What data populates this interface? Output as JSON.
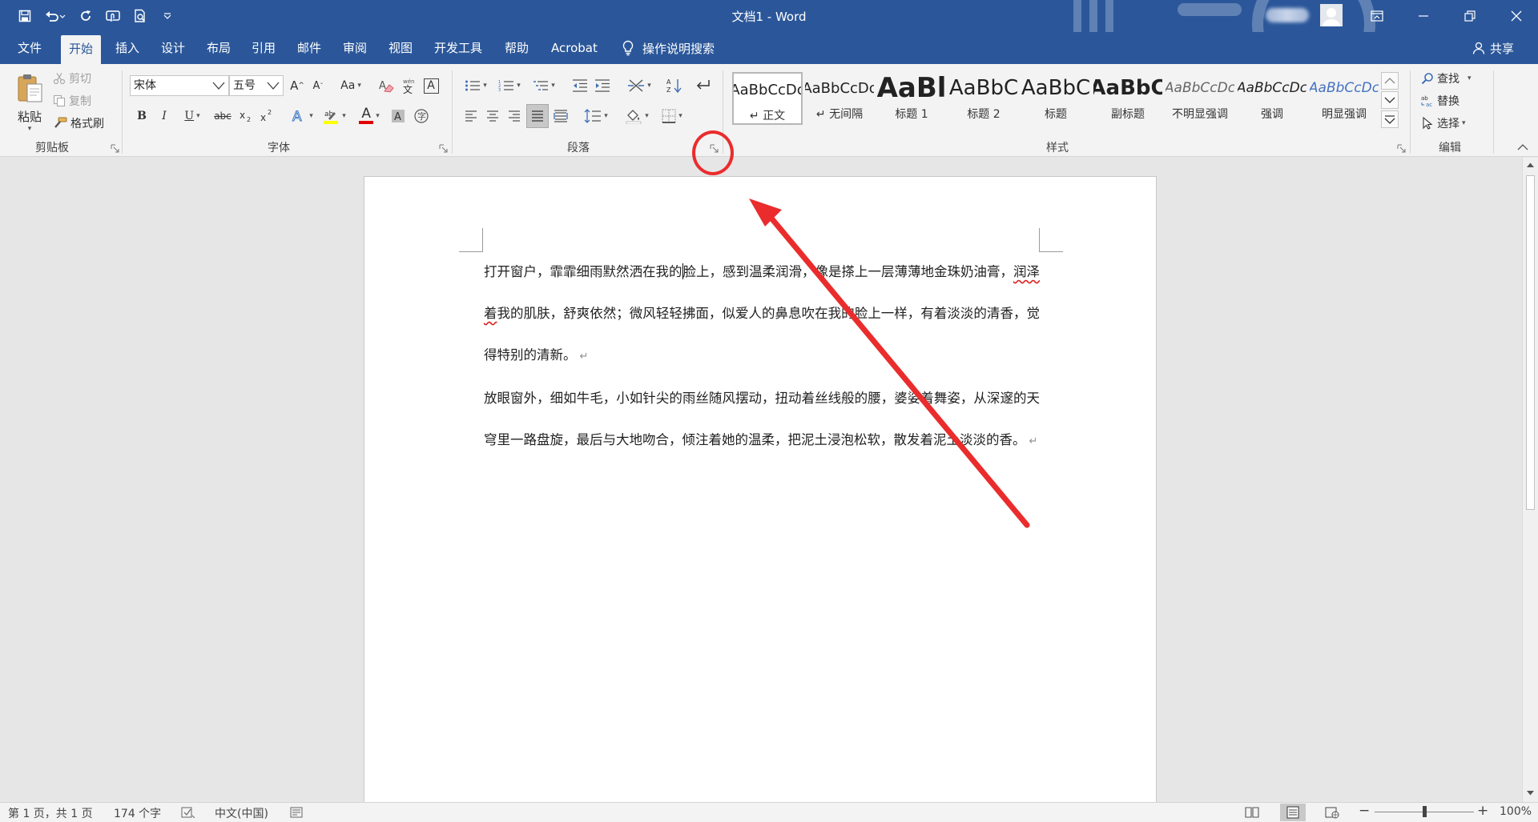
{
  "app": {
    "doc_title": "文档1 - Word"
  },
  "qat": [
    {
      "name": "save-button"
    },
    {
      "name": "undo-button"
    },
    {
      "name": "redo-button"
    },
    {
      "name": "touch-mode-button"
    },
    {
      "name": "print-preview-button"
    },
    {
      "name": "customize-qat-button"
    }
  ],
  "tabs": [
    {
      "label": "文件"
    },
    {
      "label": "开始"
    },
    {
      "label": "插入"
    },
    {
      "label": "设计"
    },
    {
      "label": "布局"
    },
    {
      "label": "引用"
    },
    {
      "label": "邮件"
    },
    {
      "label": "审阅"
    },
    {
      "label": "视图"
    },
    {
      "label": "开发工具"
    },
    {
      "label": "帮助"
    },
    {
      "label": "Acrobat"
    }
  ],
  "tell_me": "操作说明搜索",
  "share": "共享",
  "clipboard": {
    "paste": "粘贴",
    "cut": "剪切",
    "copy": "复制",
    "format_painter": "格式刷",
    "label": "剪贴板"
  },
  "font": {
    "name": "宋体",
    "size": "五号",
    "label": "字体",
    "bold": "B",
    "italic": "I",
    "underline": "U",
    "strike": "abc",
    "change_case": "Aa",
    "char_border": "A",
    "font_color": "A",
    "grow": "A",
    "shrink": "A"
  },
  "paragraph": {
    "label": "段落"
  },
  "styles": {
    "label": "样式",
    "items": [
      {
        "sample": "AaBbCcDc",
        "name": "↵ 正文"
      },
      {
        "sample": "AaBbCcDc",
        "name": "↵ 无间隔"
      },
      {
        "sample": "AaBl",
        "name": "标题 1"
      },
      {
        "sample": "AaBbC",
        "name": "标题 2"
      },
      {
        "sample": "AaBbC",
        "name": "标题"
      },
      {
        "sample": "AaBbC",
        "name": "副标题"
      },
      {
        "sample": "AaBbCcDc",
        "name": "不明显强调"
      },
      {
        "sample": "AaBbCcDc",
        "name": "强调"
      },
      {
        "sample": "AaBbCcDc",
        "name": "明显强调"
      }
    ]
  },
  "editing": {
    "label": "编辑",
    "find": "查找",
    "replace": "替换",
    "select": "选择"
  },
  "document": {
    "p1_a": "打开窗户，霏霏细雨默然洒在我的",
    "p1_b": "脸上，感到温柔润滑，像是搽上一层薄薄地金珠奶油膏，",
    "p1_squig": "润泽着",
    "p1_c": "我的肌肤，舒爽依然；微风轻轻拂面，似爱人的鼻息吹在我的脸上一样，有着淡淡的清香，觉得特别的清新。",
    "p2": "放眼窗外，细如牛毛，小如针尖的雨丝随风摆动，扭动着丝线般的腰，婆娑着舞姿，从深邃的天穹里一路盘旋，最后与大地吻合，倾注着她的温柔，把泥土浸泡松软，散发着泥土淡淡的香。",
    "para_mark": "↵"
  },
  "status": {
    "page": "第 1 页，共 1 页",
    "words": "174 个字",
    "lang": "中文(中国)",
    "zoom": "100%",
    "zoom_level": 1.0
  },
  "colors": {
    "brand": "#2b579a",
    "annotation": "#ea2c2c",
    "highlight": "#ffff00",
    "font_color": "#e00000"
  }
}
